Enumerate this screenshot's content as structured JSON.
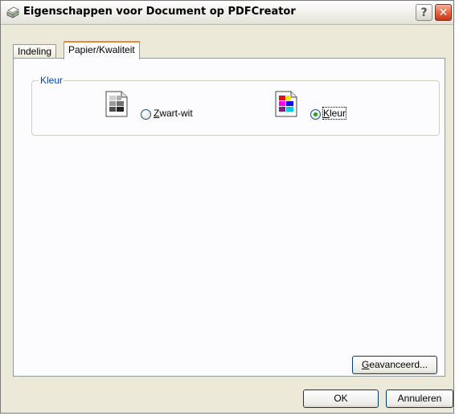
{
  "window": {
    "title": "Eigenschappen voor Document op PDFCreator",
    "help_glyph": "?",
    "close_glyph": "✕"
  },
  "tabs": [
    {
      "label": "Indeling",
      "active": false
    },
    {
      "label": "Papier/Kwaliteit",
      "active": true
    }
  ],
  "color_group": {
    "label": "Kleur",
    "options": [
      {
        "mnemonic": "Z",
        "rest": "wart-wit",
        "selected": false,
        "icon": "grayscale-printer-icon"
      },
      {
        "mnemonic": "K",
        "rest": "leur",
        "selected": true,
        "icon": "color-printer-icon"
      }
    ]
  },
  "buttons": {
    "advanced_mnemonic": "G",
    "advanced_rest": "eavanceerd...",
    "ok": "OK",
    "cancel": "Annuleren"
  },
  "colors": {
    "accent_tab": "#e68b2c",
    "group_label": "#0046d5",
    "dialog_bg": "#ece9d8",
    "radio_dot": "#21a121"
  }
}
